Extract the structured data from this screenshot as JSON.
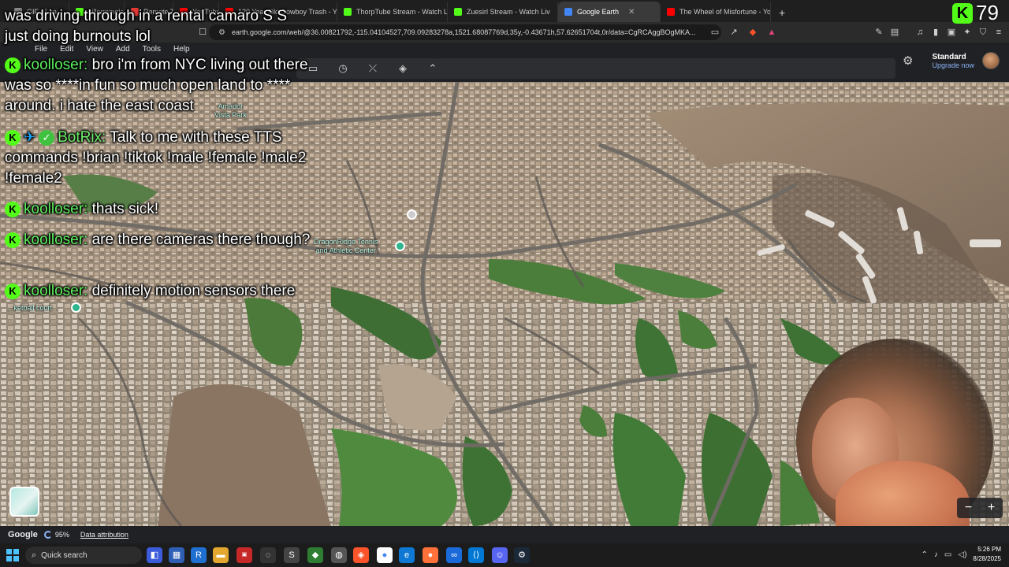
{
  "browser": {
    "tabs": [
      {
        "label": "GIF - Lea...",
        "color": "#888888"
      },
      {
        "label": "killermavrick",
        "color": "#53fc18"
      },
      {
        "label": "Remote Trop...",
        "color": "#e53935"
      },
      {
        "label": "YouTube",
        "color": "#ff0000"
      },
      {
        "label": "120 Year Old Cowboy Trash - Y",
        "color": "#ff0000"
      },
      {
        "label": "ThorpTube Stream - Watch Liv",
        "color": "#53fc18"
      },
      {
        "label": "Zuesirl Stream - Watch Liv",
        "color": "#53fc18"
      },
      {
        "label": "Google Earth",
        "color": "#4285f4",
        "active": true
      },
      {
        "label": "The Wheel of Misfortune - You",
        "color": "#ff0000"
      }
    ],
    "close_glyph": "✕",
    "newtab_glyph": "+",
    "url": "earth.google.com/web/@36.00821792,-115.04104527,709.09283278a,1521.68087769d,35y,-0.43671h,57.62651704t,0r/data=CgRCAggBOgMKA..."
  },
  "earth": {
    "menu": [
      "File",
      "Edit",
      "View",
      "Add",
      "Tools",
      "Help"
    ],
    "toolbar_icons": [
      "ruler-icon",
      "history-icon",
      "measure-icon",
      "layers-icon",
      "collapse-icon"
    ],
    "account": {
      "plan": "Standard",
      "upgrade": "Upgrade now"
    },
    "map_labels": [
      {
        "text": "Amador\nVista Park"
      },
      {
        "text": "DragonRidge Tennis\nand Athletic Center"
      },
      {
        "text": "...ketball court"
      }
    ],
    "bottom": {
      "logo": "Google",
      "zoom": "95%",
      "attribution": "Data attribution"
    },
    "zoom_out": "−",
    "zoom_in": "+"
  },
  "stream": {
    "viewer_count": "79",
    "kick_glyph": "K"
  },
  "chat": [
    {
      "user": "",
      "text": "was driving through in a rental camaro S S just doing burnouts lol",
      "continuation": true
    },
    {
      "user": "koolloser:",
      "text": "bro i'm from NYC living out there was so ****in fun so much open land to **** around. i hate the east coast"
    },
    {
      "user": "BotRix:",
      "text": "Talk to me with these TTS commands !brian !tiktok !male !female !male2 !female2",
      "bot": true
    },
    {
      "user": "koolloser:",
      "text": "thats sick!"
    },
    {
      "user": "koolloser:",
      "text": "are there cameras there though?"
    },
    {
      "user": "koolloser:",
      "text": "definitely motion sensors there"
    }
  ],
  "taskbar": {
    "search_placeholder": "Quick search",
    "time": "5:26 PM",
    "date": "8/28/2025"
  }
}
